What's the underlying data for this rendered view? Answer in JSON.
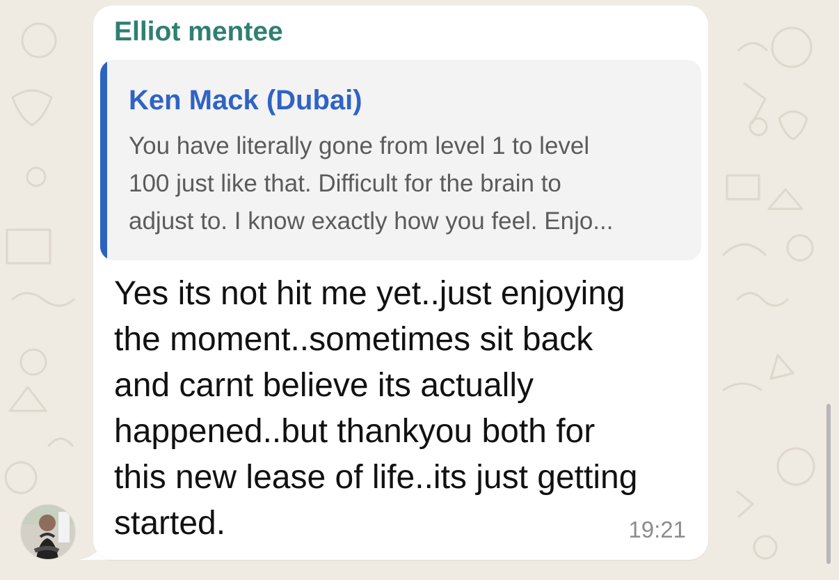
{
  "chat": {
    "sender_name": "Elliot mentee",
    "quoted_name": "Ken Mack (Dubai)",
    "quoted_lines": [
      "You have literally gone from level 1 to level",
      "100 just like that. Difficult for the brain to",
      "adjust to. I know exactly how you feel. Enjo..."
    ],
    "message_lines": [
      "Yes its not hit me yet..just enjoying",
      "the moment..sometimes sit back",
      "and carnt believe its actually",
      "happened..but thankyou both for",
      "this new lease of life..its just getting",
      "started."
    ],
    "time": "19:21"
  },
  "colors": {
    "background": "#efeae2",
    "bubble": "#ffffff",
    "sender_name": "#2f7f72",
    "quoted_bar": "#2b63bf",
    "quoted_name": "#2f63c4",
    "quoted_text": "#5b5b5b",
    "message_text": "#111111",
    "time": "#8c8c8c"
  },
  "icons": {
    "wallpaper": "doodle-pattern",
    "avatar": "avatar-icon"
  }
}
